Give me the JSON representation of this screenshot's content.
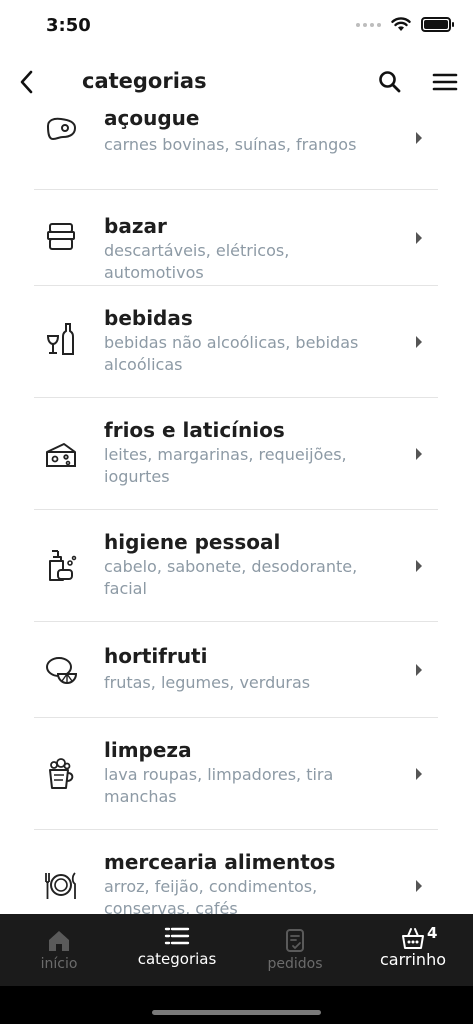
{
  "status_bar": {
    "time": "3:50"
  },
  "header": {
    "title": "categorias",
    "back_icon": "chevron-left-icon",
    "search_icon": "search-icon",
    "menu_icon": "hamburger-menu-icon"
  },
  "categories": [
    {
      "name": "açougue",
      "description": "carnes bovinas, suínas, frangos",
      "icon": "meat-steak-icon"
    },
    {
      "name": "bazar",
      "description": "descartáveis, elétricos, automotivos",
      "icon": "container-box-icon"
    },
    {
      "name": "bebidas",
      "description": "bebidas não alcoólicas, bebidas alcoólicas",
      "icon": "wine-bottle-glass-icon"
    },
    {
      "name": "frios e laticínios",
      "description": "leites, margarinas, requeijões, iogurtes",
      "icon": "cheese-icon"
    },
    {
      "name": "higiene pessoal",
      "description": "cabelo, sabonete, desodorante, facial",
      "icon": "soap-dispenser-icon"
    },
    {
      "name": "hortifruti",
      "description": "frutas, legumes, verduras",
      "icon": "lemon-icon"
    },
    {
      "name": "limpeza",
      "description": "lava roupas, limpadores, tira manchas",
      "icon": "cleaning-bucket-icon"
    },
    {
      "name": "mercearia alimentos",
      "description": "arroz, feijão, condimentos, conservas, cafés",
      "icon": "plate-cutlery-icon"
    }
  ],
  "bottom_nav": {
    "items": [
      {
        "label": "início",
        "icon": "home-icon"
      },
      {
        "label": "categorias",
        "icon": "list-icon",
        "active": true
      },
      {
        "label": "pedidos",
        "icon": "receipt-check-icon"
      },
      {
        "label": "carrinho",
        "icon": "shopping-basket-icon",
        "badge": "4"
      }
    ]
  },
  "colors": {
    "nav_background": "#1b1b1b",
    "description_text": "#8d9aa5",
    "divider": "#e4e4e4"
  }
}
